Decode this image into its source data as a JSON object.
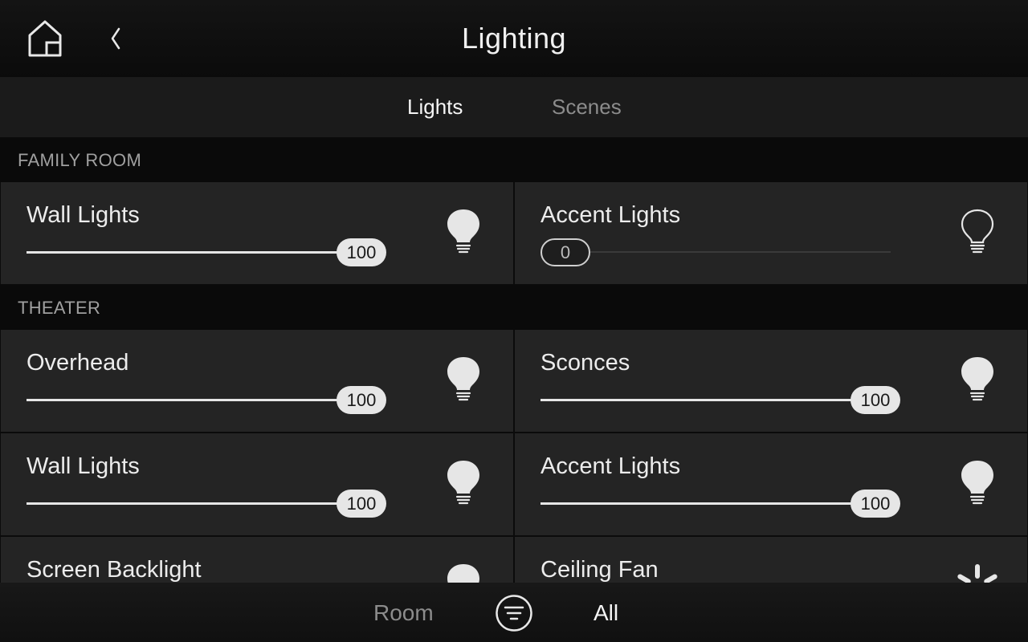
{
  "header": {
    "title": "Lighting",
    "home_icon": "home-icon",
    "back_icon": "chevron-left-icon"
  },
  "tabs": [
    {
      "label": "Lights",
      "active": true
    },
    {
      "label": "Scenes",
      "active": false
    }
  ],
  "sections": [
    {
      "title": "FAMILY ROOM",
      "cards": [
        {
          "name": "Wall Lights",
          "level": 100,
          "level_label": "100",
          "icon": "lightbulb-on-icon"
        },
        {
          "name": "Accent Lights",
          "level": 0,
          "level_label": "0",
          "icon": "lightbulb-off-icon"
        }
      ]
    },
    {
      "title": "THEATER",
      "cards": [
        {
          "name": "Overhead",
          "level": 100,
          "level_label": "100",
          "icon": "lightbulb-on-icon"
        },
        {
          "name": "Sconces",
          "level": 100,
          "level_label": "100",
          "icon": "lightbulb-on-icon"
        },
        {
          "name": "Wall Lights",
          "level": 100,
          "level_label": "100",
          "icon": "lightbulb-on-icon"
        },
        {
          "name": "Accent Lights",
          "level": 100,
          "level_label": "100",
          "icon": "lightbulb-on-icon"
        },
        {
          "name": "Screen Backlight",
          "icon": "lightbulb-on-icon"
        },
        {
          "name": "Ceiling Fan",
          "icon": "fan-icon"
        }
      ]
    }
  ],
  "bottom_bar": {
    "room_label": "Room",
    "filter_icon": "filter-icon",
    "all_label": "All"
  },
  "colors": {
    "background": "#000000",
    "card": "#242424",
    "accent": "#e6e6e6",
    "inactive_text": "#8c8c8c"
  }
}
